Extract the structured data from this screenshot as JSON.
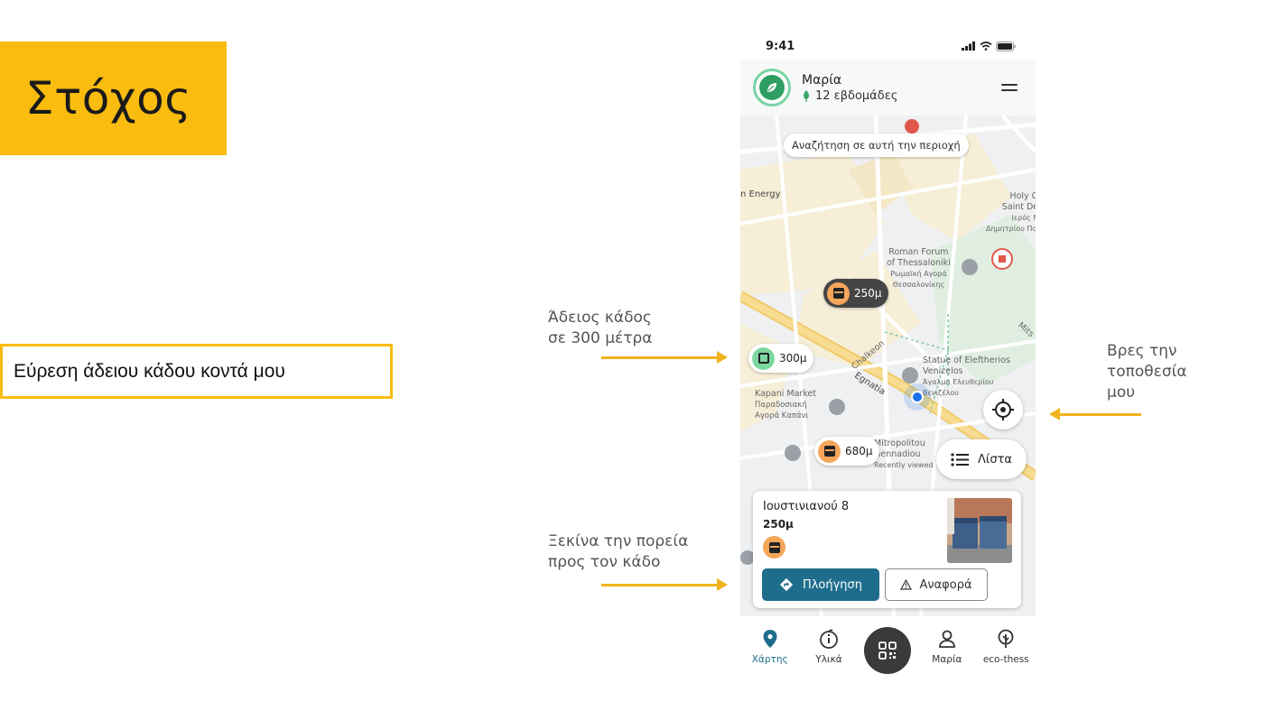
{
  "slide": {
    "goal_title": "Στόχος",
    "task": "Εύρεση άδειου κάδου κοντά μου",
    "notes": {
      "empty_bin_line1": "Άδειος κάδος",
      "empty_bin_line2": "σε 300 μέτρα",
      "start_route_line1": "Ξεκίνα την πορεία",
      "start_route_line2": "προς τον κάδο",
      "find_location_line1": "Βρες την",
      "find_location_line2": "τοποθεσία",
      "find_location_line3": "μου"
    },
    "colors": {
      "accent": "#f9bc0f",
      "arrow": "#f1b21b"
    }
  },
  "app": {
    "status_bar": {
      "time": "9:41"
    },
    "header": {
      "user_name": "Μαρία",
      "weeks": "12 εβδομάδες"
    },
    "map": {
      "search_here": "Αναζήτηση σε αυτή την περιοχή",
      "labels": {
        "energy": "n Energy",
        "holy_church_1": "Holy Chur",
        "holy_church_2": "Saint Deme",
        "holy_church_3": "Ιερός Ναός",
        "holy_church_4": "Δημητρίου Πολιού",
        "forum_1": "Roman Forum",
        "forum_2": "of Thessaloniki",
        "forum_3": "Ρωμαϊκή Αγορά",
        "forum_4": "Θεσσαλονίκης",
        "chalkeon": "Chalkeon",
        "egnatia": "Egnatia",
        "statue_1": "Statue of Eleftherios",
        "statue_2": "Venizelos",
        "statue_3": "Άγαλμα Ελευθερίου",
        "statue_4": "Βενιζέλου",
        "kapani_1": "Kapani Market",
        "kapani_2": "Παραδοσιακή",
        "kapani_3": "Αγορά Καπάνι",
        "mitropolitou_1": "Mitropolitou",
        "mitropolitou_2": "Gennadiou",
        "recently_viewed": "Recently viewed",
        "mits": "Mits"
      },
      "pins": [
        {
          "distance": "250μ",
          "style": "dark",
          "status": "orange"
        },
        {
          "distance": "300μ",
          "style": "light",
          "status": "green"
        },
        {
          "distance": "680μ",
          "style": "light",
          "status": "orange"
        }
      ],
      "list_button": "Λίστα"
    },
    "bin_card": {
      "address": "Ιουστινιανού 8",
      "distance": "250μ",
      "navigate_button": "Πλοήγηση",
      "report_button": "Αναφορά"
    },
    "bottom_nav": [
      {
        "label": "Χάρτης",
        "icon": "map-pin-icon",
        "active": true
      },
      {
        "label": "Υλικά",
        "icon": "info-icon",
        "active": false
      },
      {
        "label": "",
        "icon": "qr-code-icon",
        "active": false
      },
      {
        "label": "Μαρία",
        "icon": "profile-icon",
        "active": false
      },
      {
        "label": "eco-thess",
        "icon": "tree-icon",
        "active": false
      }
    ],
    "colors": {
      "primary": "#1f6d8c",
      "green": "#7dd7a0",
      "orange": "#f5a65b",
      "user_location": "#1a73e8"
    }
  }
}
